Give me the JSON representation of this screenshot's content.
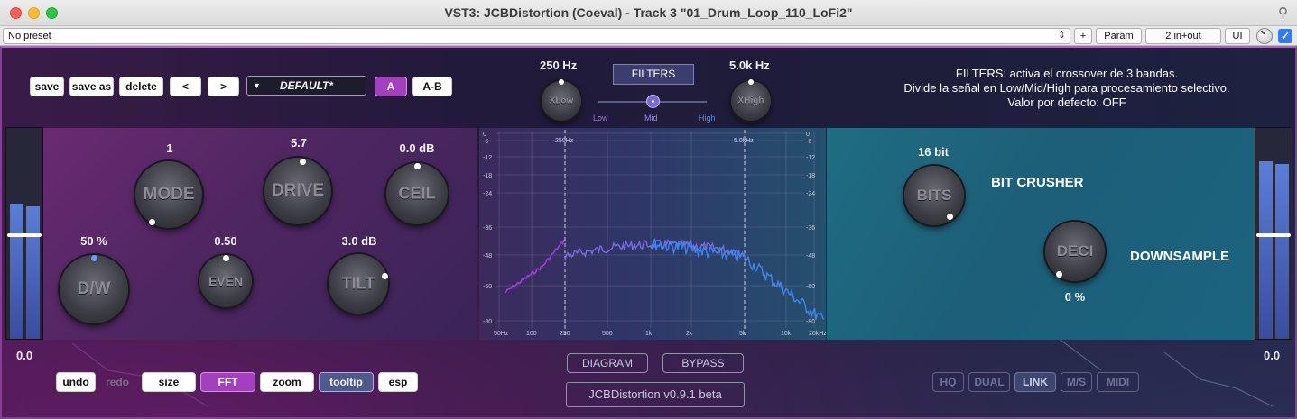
{
  "window": {
    "title": "VST3: JCBDistortion (Coeval) - Track 3 \"01_Drum_Loop_110_LoFi2\""
  },
  "host": {
    "preset": "No preset",
    "plus_label": "+",
    "param_label": "Param",
    "io_label": "2 in+out",
    "ui_label": "UI"
  },
  "toolbar": {
    "save": "save",
    "save_as": "save as",
    "delete": "delete",
    "prev": "<",
    "next": ">",
    "preset_name": "DEFAULT*",
    "a": "A",
    "ab": "A-B"
  },
  "filters": {
    "button": "FILTERS",
    "low_freq": "250 Hz",
    "high_freq": "5.0k Hz",
    "xlow_label": "XLow",
    "xhigh_label": "XHigh",
    "slider_labels": [
      "Low",
      "Mid",
      "High"
    ],
    "slider_position": "Mid"
  },
  "tooltip": {
    "lines": [
      "FILTERS: activa el crossover de 3 bandas.",
      "Divide la señal en Low/Mid/High para procesamiento selectivo.",
      "Valor por defecto: OFF"
    ]
  },
  "knobs": {
    "mode": {
      "label": "MODE",
      "value": "1"
    },
    "drive": {
      "label": "DRIVE",
      "value": "5.7"
    },
    "ceil": {
      "label": "CEIL",
      "value": "0.0 dB"
    },
    "dw": {
      "label": "D/W",
      "value": "50 %"
    },
    "even": {
      "label": "EVEN",
      "value": "0.50"
    },
    "tilt": {
      "label": "TILT",
      "value": "3.0 dB"
    },
    "bits": {
      "label": "BITS",
      "value": "16 bit"
    },
    "deci": {
      "label": "DECI",
      "value": "0 %"
    }
  },
  "sections": {
    "bitcrusher": "BIT CRUSHER",
    "downsample": "DOWNSAMPLE"
  },
  "meters": {
    "left_value": "0.0",
    "right_value": "0.0"
  },
  "bottom_left": {
    "undo": "undo",
    "redo": "redo",
    "size": "size",
    "fft": "FFT",
    "zoom": "zoom",
    "tooltip": "tooltip",
    "esp": "esp"
  },
  "bottom_center": {
    "diagram": "DIAGRAM",
    "bypass": "BYPASS",
    "version": "JCBDistortion v0.9.1 beta"
  },
  "bottom_right": {
    "hq": "HQ",
    "dual": "DUAL",
    "link": "LINK",
    "ms": "M/S",
    "midi": "MIDI"
  },
  "spectrum": {
    "db_ticks": [
      "0",
      "-6",
      "-12",
      "-18",
      "-24",
      "-36",
      "-48",
      "-60",
      "-80"
    ],
    "freq_ticks": [
      "50Hz",
      "100",
      "250",
      "500",
      "1k",
      "2k",
      "5k",
      "10k",
      "20kHz"
    ],
    "crossover_labels": [
      "250Hz",
      "5.0kHz"
    ]
  }
}
